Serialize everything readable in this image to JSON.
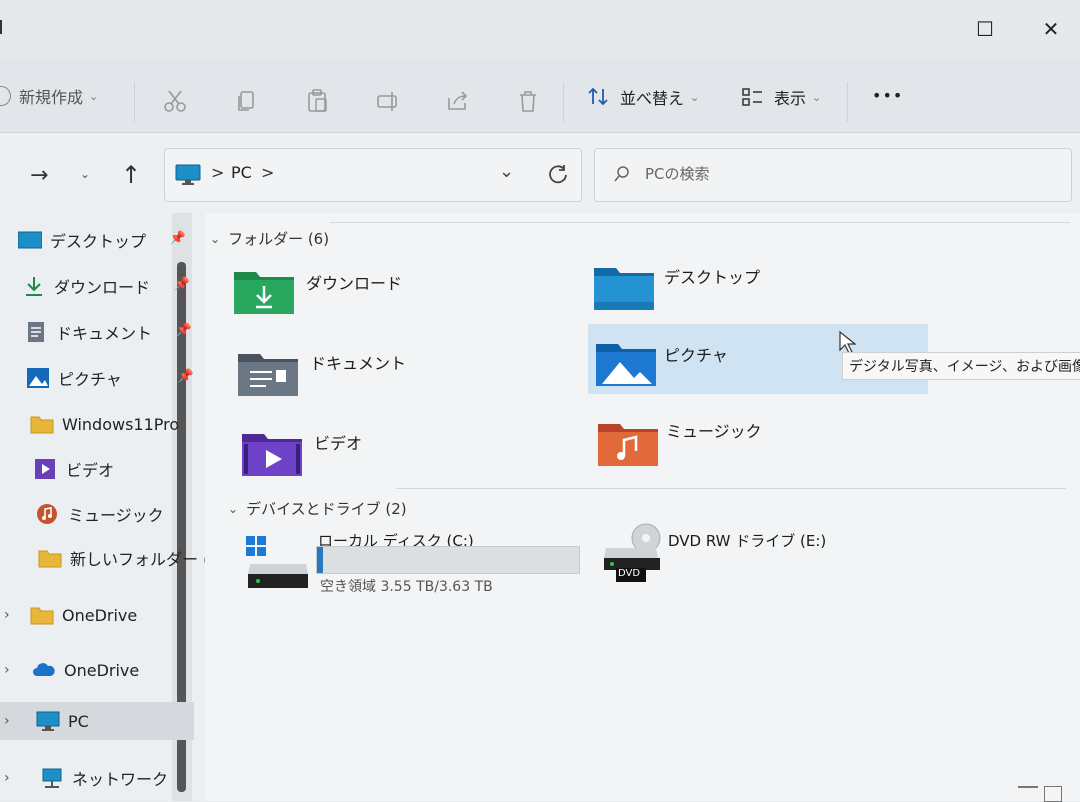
{
  "window": {
    "maximize_glyph": "☐",
    "close_glyph": "✕"
  },
  "toolbar": {
    "new_label": "新規作成",
    "sort_label": "並べ替え",
    "view_label": "表示",
    "more_label": "•••"
  },
  "address": {
    "breadcrumb": [
      ">",
      "PC",
      ">"
    ],
    "search_placeholder": "PCの検索"
  },
  "nav": {
    "items": [
      {
        "label": "デスクトップ",
        "icon": "desktop-icon",
        "pinned": true
      },
      {
        "label": "ダウンロード",
        "icon": "download-icon",
        "pinned": true
      },
      {
        "label": "ドキュメント",
        "icon": "document-icon",
        "pinned": true
      },
      {
        "label": "ピクチャ",
        "icon": "pictures-icon",
        "pinned": true
      },
      {
        "label": "Windows11Pro",
        "icon": "folder-icon",
        "pinned": false
      },
      {
        "label": "ビデオ",
        "icon": "video-icon",
        "pinned": false
      },
      {
        "label": "ミュージック",
        "icon": "music-icon",
        "pinned": false
      },
      {
        "label": "新しいフォルダー (",
        "icon": "folder-icon",
        "pinned": false
      },
      {
        "label": "OneDrive",
        "icon": "folder-icon",
        "pinned": false
      },
      {
        "label": "OneDrive",
        "icon": "cloud-icon",
        "pinned": false
      },
      {
        "label": "PC",
        "icon": "pc-icon",
        "pinned": false
      },
      {
        "label": "ネットワーク",
        "icon": "network-icon",
        "pinned": false
      }
    ]
  },
  "content": {
    "folders_header": "フォルダー (6)",
    "folders": [
      {
        "label": "ダウンロード",
        "icon": "download-folder-icon"
      },
      {
        "label": "デスクトップ",
        "icon": "desktop-folder-icon"
      },
      {
        "label": "ドキュメント",
        "icon": "documents-folder-icon"
      },
      {
        "label": "ピクチャ",
        "icon": "pictures-folder-icon"
      },
      {
        "label": "ビデオ",
        "icon": "videos-folder-icon"
      },
      {
        "label": "ミュージック",
        "icon": "music-folder-icon"
      }
    ],
    "tooltip": "デジタル写真、イメージ、および画像フ",
    "drives_header": "デバイスとドライブ (2)",
    "drives": [
      {
        "label": "ローカル ディスク (C:)",
        "free_text": "空き領域 3.55 TB/3.63 TB",
        "used_fraction": 0.022
      },
      {
        "label": "DVD RW ドライブ (E:)",
        "badge": "DVD"
      }
    ]
  },
  "colors": {
    "accent": "#2a78c4",
    "selection": "#cfe3f3"
  }
}
